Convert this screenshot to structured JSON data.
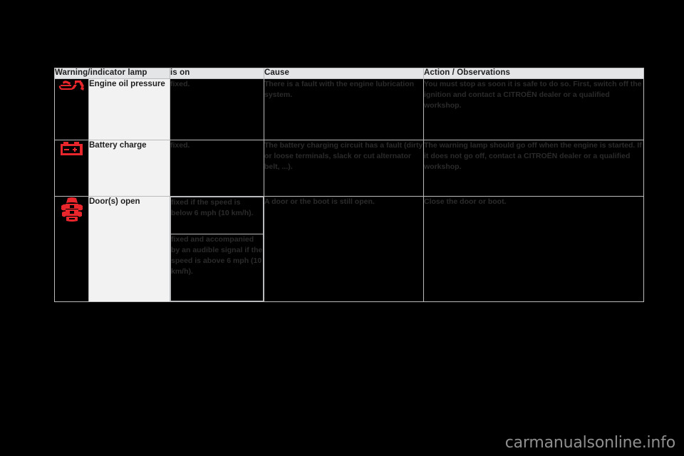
{
  "table": {
    "headers": [
      "Warning/indicator lamp",
      "is on",
      "Cause",
      "Action / Observations"
    ],
    "rows": [
      {
        "icon": "oil-can-icon",
        "icon_color": "#e8262b",
        "name": "Engine oil pressure",
        "is_on": "fixed.",
        "cause": "There is a fault with the engine lubrication system.",
        "action": "You must stop as soon it is safe to do so. First, switch off the ignition and contact a CITROËN dealer or a qualified workshop."
      },
      {
        "icon": "battery-icon",
        "icon_color": "#e8262b",
        "name": "Battery charge",
        "is_on": "fixed.",
        "cause": "The battery charging circuit has a fault (dirty or loose terminals, slack or cut alternator belt, ...).",
        "action": "The warning lamp should go off when the engine is started. If it does not go off, contact a CITROËN dealer or a qualified workshop."
      },
      {
        "icon": "car-doors-open-icon",
        "icon_color": "#e8262b",
        "name": "Door(s) open",
        "is_on_split": [
          "fixed if the speed is below 6 mph (10 km/h).",
          "fixed and accompanied by an audible signal if the speed is above 6 mph (10 km/h)."
        ],
        "cause": "A door or the boot is still open.",
        "action": "Close the door or boot."
      }
    ]
  },
  "watermark": "carmanualsonline.info",
  "colors": {
    "page_background": "#000000",
    "header_background": "#e4e5e7",
    "name_cell_background": "#f2f2f2",
    "border": "#b9bbbd",
    "lamp_red": "#e8262b",
    "dark_cell_text": "#2b2b2b",
    "watermark_text": "#8f8f8f"
  }
}
